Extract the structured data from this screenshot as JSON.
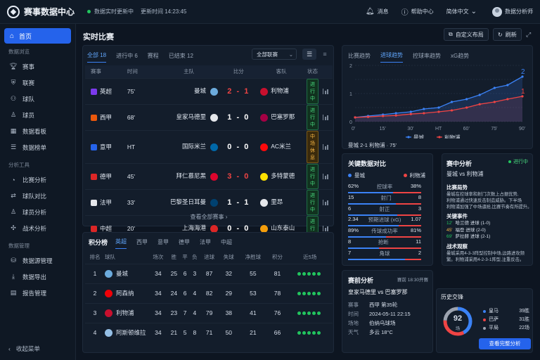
{
  "app": {
    "title": "赛事数据中心",
    "live_status": "数据实时更新中",
    "update_time": "更新时间 14:23:45"
  },
  "topbar": {
    "messages": "消息",
    "help": "帮助中心",
    "language": "简体中文",
    "user": "数据分析师"
  },
  "sidebar": {
    "home": "首页",
    "section1": "数据浏览",
    "items1": [
      {
        "icon": "trophy-icon",
        "label": "赛事"
      },
      {
        "icon": "shield-icon",
        "label": "联赛"
      },
      {
        "icon": "team-icon",
        "label": "球队"
      },
      {
        "icon": "player-icon",
        "label": "球员"
      },
      {
        "icon": "dashboard-icon",
        "label": "数据看板"
      },
      {
        "icon": "list-icon",
        "label": "数据榜单"
      }
    ],
    "section2": "分析工具",
    "items2": [
      {
        "icon": "chart-icon",
        "label": "比赛分析"
      },
      {
        "icon": "compare-icon",
        "label": "球队对比"
      },
      {
        "icon": "user-chart-icon",
        "label": "球员分析"
      },
      {
        "icon": "tactics-icon",
        "label": "战术分析"
      }
    ],
    "section3": "数据管理",
    "items3": [
      {
        "icon": "database-icon",
        "label": "数据源管理"
      },
      {
        "icon": "download-icon",
        "label": "数据导出"
      },
      {
        "icon": "report-icon",
        "label": "报告管理"
      }
    ],
    "collapse": "收起菜单"
  },
  "main": {
    "title": "实时比赛",
    "custom_layout": "自定义布局",
    "refresh": "刷新"
  },
  "live": {
    "tabs": [
      "全部 18",
      "进行中 6",
      "赛程",
      "已结束 12"
    ],
    "league_select": "全部联赛",
    "columns": [
      "赛事",
      "时间",
      "主队",
      "比分",
      "客队",
      "状态"
    ],
    "rows": [
      {
        "league": "英超",
        "time": "75'",
        "home": "曼城",
        "score": "2 - 1",
        "away": "利物浦",
        "status": "进行中",
        "score_color": "#ef4444",
        "lc": "#7c3aed",
        "hc": "#6cabdd",
        "ac": "#c8102e"
      },
      {
        "league": "西甲",
        "time": "68'",
        "home": "皇家马德里",
        "score": "1 - 0",
        "away": "巴塞罗那",
        "status": "进行中",
        "score_color": "#ffffff",
        "lc": "#ea580c",
        "hc": "#e5e7eb",
        "ac": "#a50044"
      },
      {
        "league": "意甲",
        "time": "HT",
        "home": "国际米兰",
        "score": "0 - 0",
        "away": "AC米兰",
        "status": "中场休息",
        "score_color": "#ffffff",
        "lc": "#2563eb",
        "hc": "#0068a8",
        "ac": "#fb090b"
      },
      {
        "league": "德甲",
        "time": "45'",
        "home": "拜仁慕尼黑",
        "score": "3 - 0",
        "away": "多特蒙德",
        "status": "进行中",
        "score_color": "#ef4444",
        "lc": "#dc2626",
        "hc": "#dc052d",
        "ac": "#fde100"
      },
      {
        "league": "法甲",
        "time": "33'",
        "home": "巴黎圣日耳曼",
        "score": "1 - 1",
        "away": "里昂",
        "status": "进行中",
        "score_color": "#ffffff",
        "lc": "#e5e7eb",
        "hc": "#004170",
        "ac": "#e5e7eb"
      },
      {
        "league": "中超",
        "time": "20'",
        "home": "上海海港",
        "score": "0 - 0",
        "away": "山东泰山",
        "status": "进行中",
        "score_color": "#ffffff",
        "lc": "#dc2626",
        "hc": "#dc2626",
        "ac": "#f59e0b"
      }
    ],
    "view_all": "查看全部赛事  ›"
  },
  "standings": {
    "title": "积分榜",
    "tabs": [
      "英超",
      "西甲",
      "意甲",
      "德甲",
      "法甲",
      "中超"
    ],
    "columns": [
      "排名",
      "球队",
      "场次",
      "胜",
      "平",
      "负",
      "进球",
      "失球",
      "净胜球",
      "积分",
      "近5场"
    ],
    "rows": [
      {
        "rank": "1",
        "team": "曼城",
        "p": "34",
        "w": "25",
        "d": "6",
        "l": "3",
        "gf": "87",
        "ga": "32",
        "gd": "55",
        "pts": "81",
        "c": "#6cabdd"
      },
      {
        "rank": "2",
        "team": "阿森纳",
        "p": "34",
        "w": "24",
        "d": "6",
        "l": "4",
        "gf": "82",
        "ga": "29",
        "gd": "53",
        "pts": "78",
        "c": "#ef0107"
      },
      {
        "rank": "3",
        "team": "利物浦",
        "p": "34",
        "w": "23",
        "d": "7",
        "l": "4",
        "gf": "79",
        "ga": "38",
        "gd": "41",
        "pts": "76",
        "c": "#c8102e"
      },
      {
        "rank": "4",
        "team": "阿斯顿维拉",
        "p": "34",
        "w": "21",
        "d": "5",
        "l": "8",
        "gf": "71",
        "ga": "50",
        "gd": "21",
        "pts": "66",
        "c": "#95bfe5"
      }
    ]
  },
  "trend": {
    "tabs": [
      "比赛趋势",
      "进球趋势",
      "控球率趋势",
      "xG趋势"
    ],
    "summary": "曼城 2-1 利物浦 · 75'"
  },
  "chart_data": {
    "type": "line",
    "x": [
      "0'",
      "15'",
      "30'",
      "HT",
      "60'",
      "75'",
      "90'"
    ],
    "ylim": [
      0,
      2
    ],
    "yticks": [
      "0",
      "1",
      "2"
    ],
    "series": [
      {
        "name": "曼城",
        "color": "#3b82f6",
        "xs": [
          0,
          7,
          15,
          22,
          30,
          37,
          45,
          52,
          60,
          67,
          75,
          82,
          90
        ],
        "values": [
          0.15,
          0.2,
          0.25,
          0.3,
          0.35,
          0.45,
          0.5,
          0.7,
          0.8,
          0.95,
          1.2,
          1.3,
          1.6
        ]
      },
      {
        "name": "利物浦",
        "color": "#ef4444",
        "xs": [
          0,
          7,
          15,
          22,
          30,
          37,
          45,
          52,
          60,
          67,
          75,
          82,
          90
        ],
        "values": [
          0.15,
          0.17,
          0.2,
          0.22,
          0.27,
          0.3,
          0.35,
          0.4,
          0.5,
          0.62,
          0.7,
          0.8,
          0.9
        ]
      }
    ],
    "end_labels": [
      "2",
      "1"
    ]
  },
  "keystats": {
    "title": "关键数据对比",
    "home": "曼城",
    "away": "利物浦",
    "rows": [
      {
        "l": "62%",
        "c": "控球率",
        "r": "38%",
        "p": 0.62
      },
      {
        "l": "15",
        "c": "射门",
        "r": "8",
        "p": 0.65
      },
      {
        "l": "6",
        "c": "射正",
        "r": "3",
        "p": 0.67
      },
      {
        "l": "2.34",
        "c": "预期进球 (xG)",
        "r": "1.07",
        "p": 0.69
      },
      {
        "l": "89%",
        "c": "传球成功率",
        "r": "81%",
        "p": 0.52
      },
      {
        "l": "8",
        "c": "抢断",
        "r": "11",
        "p": 0.42
      },
      {
        "l": "7",
        "c": "角球",
        "r": "2",
        "p": 0.78
      }
    ]
  },
  "match_analysis": {
    "title": "赛中分析",
    "status": "进行中",
    "teams": "曼城 vs 利物浦",
    "s1": "比赛局势",
    "s1_text": [
      "曼城在控球率和射门次数上占据优势,",
      "利物浦通过快速反击制造威胁。下半场",
      "利物浦加强了中场逼抢,比赛节奏有所提升。"
    ],
    "s2": "关键事件",
    "events": [
      {
        "t": "12'",
        "e": "哈兰德 进球 (1-0)",
        "c": "#22c55e"
      },
      {
        "t": "45'",
        "e": "福登 进球 (2-0)",
        "c": "#f5b544"
      },
      {
        "t": "69'",
        "e": "萨拉赫 进球 (2-1)",
        "c": "#22c55e"
      }
    ],
    "s3": "战术观察",
    "s3_text": [
      "曼城采用4-3-3阵型控制中场,边路进攻频",
      "繁。利物浦采用4-2-3-1阵型,注重反击。"
    ]
  },
  "preview": {
    "title": "赛前分析",
    "time": "赛前 18:30开赛",
    "teams": "皇家马德里  vs  巴塞罗那",
    "rows": [
      {
        "k": "赛事",
        "v": "西甲 第35轮"
      },
      {
        "k": "时间",
        "v": "2024-05-11 22:15"
      },
      {
        "k": "场地",
        "v": "伯纳乌球场"
      },
      {
        "k": "天气",
        "v": "多云 18°C"
      }
    ]
  },
  "h2h": {
    "title": "历史交锋",
    "total": "92",
    "unit": "场",
    "items": [
      {
        "name": "皇马",
        "value": "39胜",
        "count": 39,
        "color": "#3b82f6"
      },
      {
        "name": "巴萨",
        "value": "31胜",
        "count": 31,
        "color": "#ef4444"
      },
      {
        "name": "平局",
        "value": "22场",
        "count": 22,
        "color": "#9ca3af"
      }
    ],
    "button": "查看完整分析"
  }
}
